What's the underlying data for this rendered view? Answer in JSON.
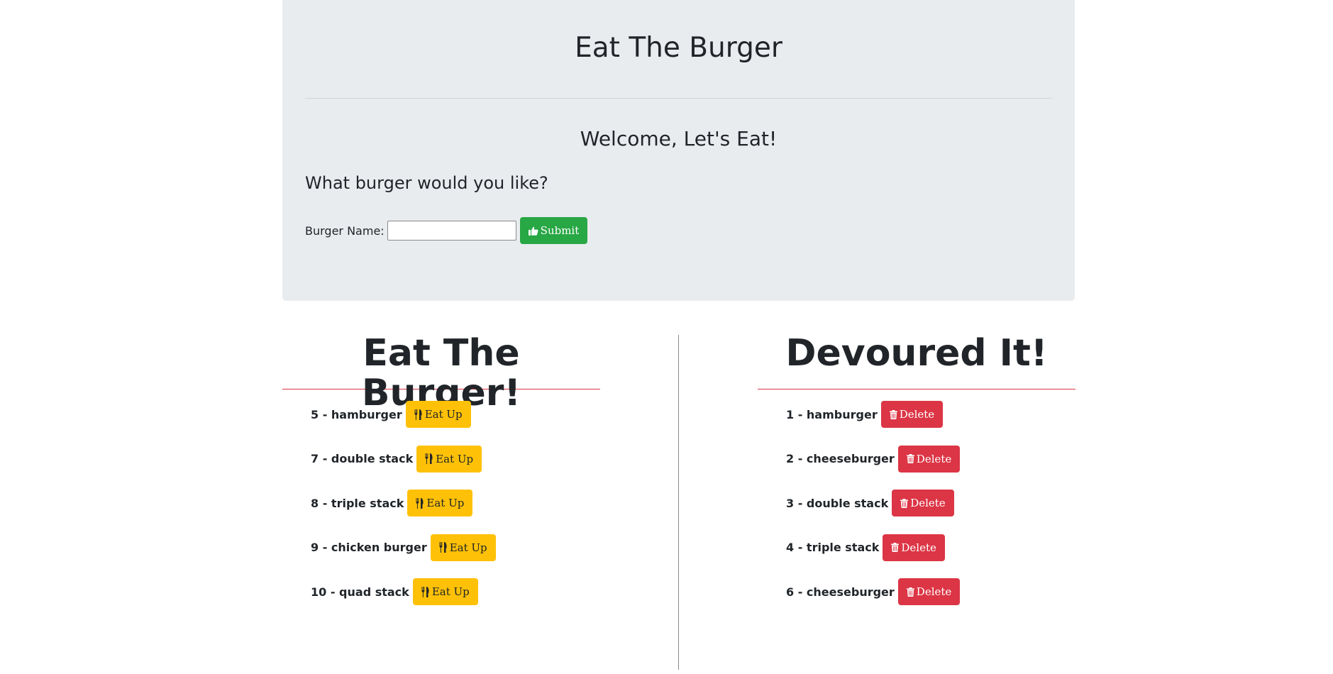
{
  "header": {
    "title": "Eat The Burger",
    "welcome": "Welcome, Let's Eat!",
    "prompt": "What burger would you like?"
  },
  "form": {
    "label": "Burger Name:",
    "input_value": "",
    "submit_label": "Submit",
    "submit_icon": "thumbs-up-icon"
  },
  "uneaten": {
    "title": "Eat The Burger!",
    "button_label": "Eat Up",
    "button_icon": "utensils-icon",
    "items": [
      {
        "label": "5 - hamburger"
      },
      {
        "label": "7 - double stack"
      },
      {
        "label": "8 - triple stack"
      },
      {
        "label": "9 - chicken burger"
      },
      {
        "label": "10 - quad stack"
      }
    ]
  },
  "devoured": {
    "title": "Devoured It!",
    "button_label": "Delete",
    "button_icon": "trash-icon",
    "items": [
      {
        "label": "1 - hamburger"
      },
      {
        "label": "2 - cheeseburger"
      },
      {
        "label": "3 - double stack"
      },
      {
        "label": "4 - triple stack"
      },
      {
        "label": "6 - cheeseburger"
      }
    ]
  },
  "colors": {
    "jumbotron_bg": "#e9ecef",
    "success": "#28a745",
    "warning": "#ffc107",
    "danger": "#dc3545"
  }
}
